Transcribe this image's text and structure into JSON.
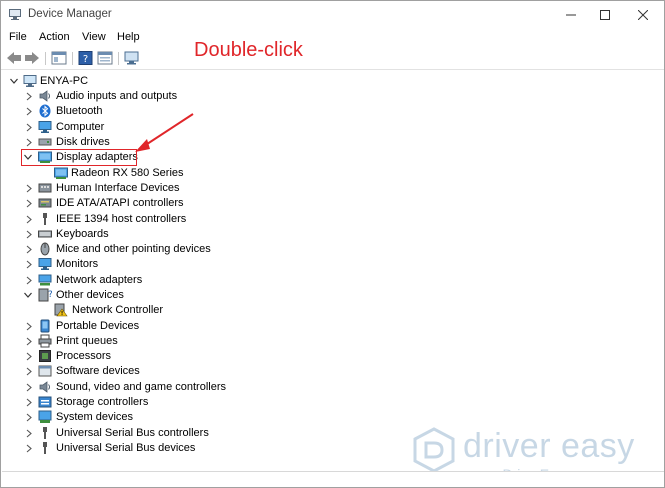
{
  "window": {
    "title": "Device Manager"
  },
  "menu": [
    "File",
    "Action",
    "View",
    "Help"
  ],
  "annotation": {
    "text": "Double-click",
    "color": "#e0262a"
  },
  "tree": {
    "root": "ENYA-PC",
    "items": [
      {
        "label": "Audio inputs and outputs",
        "icon": "speaker-icon",
        "expanded": false
      },
      {
        "label": "Bluetooth",
        "icon": "bluetooth-icon",
        "expanded": false
      },
      {
        "label": "Computer",
        "icon": "monitor-icon",
        "expanded": false
      },
      {
        "label": "Disk drives",
        "icon": "disk-drive-icon",
        "expanded": false
      },
      {
        "label": "Display adapters",
        "icon": "display-adapter-icon",
        "expanded": true,
        "highlighted": true,
        "children": [
          {
            "label": "Radeon RX 580 Series",
            "icon": "display-adapter-icon"
          }
        ]
      },
      {
        "label": "Human Interface Devices",
        "icon": "hid-icon",
        "expanded": false
      },
      {
        "label": "IDE ATA/ATAPI controllers",
        "icon": "ide-controller-icon",
        "expanded": false
      },
      {
        "label": "IEEE 1394 host controllers",
        "icon": "ieee1394-icon",
        "expanded": false
      },
      {
        "label": "Keyboards",
        "icon": "keyboard-icon",
        "expanded": false
      },
      {
        "label": "Mice and other pointing devices",
        "icon": "mouse-icon",
        "expanded": false
      },
      {
        "label": "Monitors",
        "icon": "monitor-icon",
        "expanded": false
      },
      {
        "label": "Network adapters",
        "icon": "network-adapter-icon",
        "expanded": false
      },
      {
        "label": "Other devices",
        "icon": "unknown-device-icon",
        "expanded": true,
        "children": [
          {
            "label": "Network Controller",
            "icon": "warning-device-icon"
          }
        ]
      },
      {
        "label": "Portable Devices",
        "icon": "portable-device-icon",
        "expanded": false
      },
      {
        "label": "Print queues",
        "icon": "printer-icon",
        "expanded": false
      },
      {
        "label": "Processors",
        "icon": "processor-icon",
        "expanded": false
      },
      {
        "label": "Software devices",
        "icon": "software-device-icon",
        "expanded": false
      },
      {
        "label": "Sound, video and game controllers",
        "icon": "speaker-icon",
        "expanded": false
      },
      {
        "label": "Storage controllers",
        "icon": "storage-controller-icon",
        "expanded": false
      },
      {
        "label": "System devices",
        "icon": "system-device-icon",
        "expanded": false
      },
      {
        "label": "Universal Serial Bus controllers",
        "icon": "usb-icon",
        "expanded": false
      },
      {
        "label": "Universal Serial Bus devices",
        "icon": "usb-icon",
        "expanded": false
      }
    ]
  },
  "watermark": {
    "brand": "driver easy",
    "url": "www.DriverEasy.com"
  }
}
